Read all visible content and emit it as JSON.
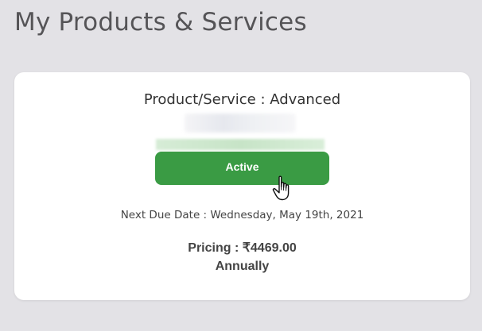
{
  "page": {
    "title": "My Products & Services"
  },
  "product_card": {
    "title": "Product/Service : Advanced",
    "status_label": "Active",
    "status_color": "#3a9b44",
    "next_due_date": "Next Due Date : Wednesday, May 19th, 2021",
    "pricing": "Pricing : ₹4469.00",
    "billing_cycle": "Annually"
  },
  "cursor": {
    "icon": "hand-pointer-icon"
  }
}
